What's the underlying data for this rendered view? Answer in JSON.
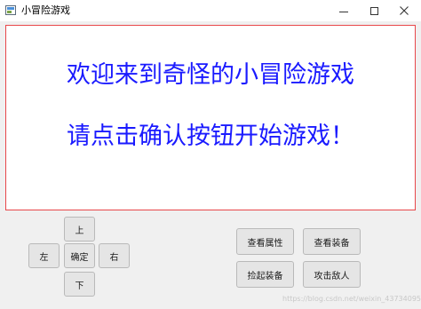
{
  "window": {
    "title": "小冒险游戏"
  },
  "display": {
    "line1": "欢迎来到奇怪的小冒险游戏",
    "line2": "请点击确认按钮开始游戏！"
  },
  "direction_pad": {
    "up": "上",
    "left": "左",
    "confirm": "确定",
    "right": "右",
    "down": "下"
  },
  "actions": {
    "view_attributes": "查看属性",
    "view_equipment": "查看装备",
    "pick_up_equipment": "捡起装备",
    "attack_enemy": "攻击敌人"
  },
  "watermark": "https://blog.csdn.net/weixin_43734095",
  "colors": {
    "message_text": "#1a1aff",
    "display_border": "#e8474a"
  }
}
